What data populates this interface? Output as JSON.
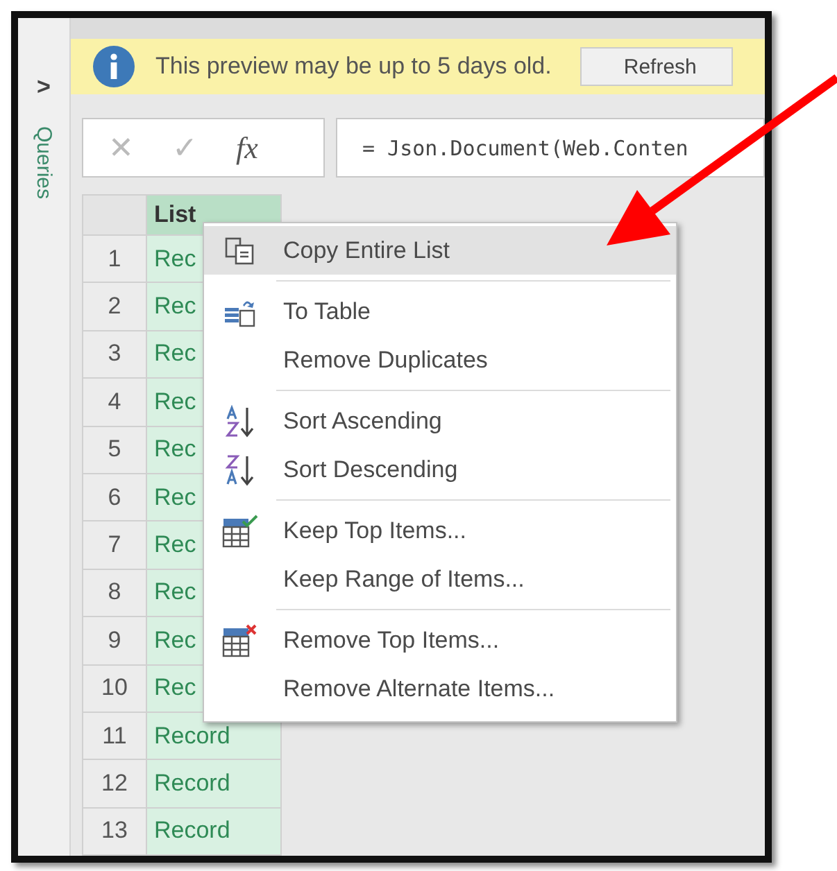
{
  "queries_pane": {
    "expand_glyph": ">",
    "label": "Queries"
  },
  "info_bar": {
    "message": "This preview may be up to 5 days old.",
    "button": "Refresh"
  },
  "formula_bar": {
    "cancel": "✕",
    "confirm": "✓",
    "fx": "fx",
    "formula": "= Json.Document(Web.Conten"
  },
  "table": {
    "columns": [
      "List"
    ],
    "rows": [
      {
        "number": "1",
        "value": "Rec"
      },
      {
        "number": "2",
        "value": "Rec"
      },
      {
        "number": "3",
        "value": "Rec"
      },
      {
        "number": "4",
        "value": "Rec"
      },
      {
        "number": "5",
        "value": "Rec"
      },
      {
        "number": "6",
        "value": "Rec"
      },
      {
        "number": "7",
        "value": "Rec"
      },
      {
        "number": "8",
        "value": "Rec"
      },
      {
        "number": "9",
        "value": "Rec"
      },
      {
        "number": "10",
        "value": "Rec"
      },
      {
        "number": "11",
        "value": "Record"
      },
      {
        "number": "12",
        "value": "Record"
      },
      {
        "number": "13",
        "value": "Record"
      }
    ]
  },
  "context_menu": {
    "groups": [
      {
        "items": [
          {
            "label": "Copy Entire List",
            "selected": true
          }
        ]
      },
      {
        "items": [
          {
            "label": "To Table",
            "selected": false
          },
          {
            "label": "Remove Duplicates",
            "selected": false
          }
        ]
      },
      {
        "items": [
          {
            "label": "Sort Ascending",
            "selected": false
          },
          {
            "label": "Sort Descending",
            "selected": false
          }
        ]
      },
      {
        "items": [
          {
            "label": "Keep Top Items...",
            "selected": false
          },
          {
            "label": "Keep Range of Items...",
            "selected": false
          }
        ]
      },
      {
        "items": [
          {
            "label": "Remove Top Items...",
            "selected": false
          },
          {
            "label": "Remove Alternate Items...",
            "selected": false
          }
        ]
      }
    ]
  }
}
